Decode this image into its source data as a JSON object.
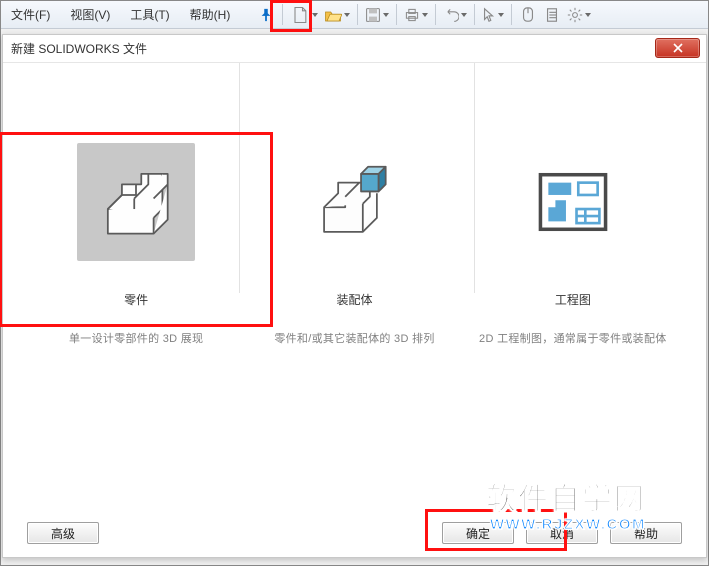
{
  "menubar": {
    "file": "文件(F)",
    "view": "视图(V)",
    "tools": "工具(T)",
    "help": "帮助(H)"
  },
  "toolbar_icons": {
    "pin": "pin-icon",
    "new_doc": "new-document-icon",
    "open": "open-icon",
    "save": "save-icon",
    "print": "print-icon",
    "undo": "undo-icon",
    "cursor": "cursor-icon",
    "rebuild": "rebuild-icon",
    "options_sheet": "options-sheet-icon",
    "settings": "gear-icon"
  },
  "dialog": {
    "title": "新建 SOLIDWORKS 文件",
    "options": [
      {
        "name": "零件",
        "desc": "单一设计零部件的 3D 展现"
      },
      {
        "name": "装配体",
        "desc": "零件和/或其它装配体的 3D 排列"
      },
      {
        "name": "工程图",
        "desc": "2D 工程制图，通常属于零件或装配体"
      }
    ],
    "buttons": {
      "advanced": "高级",
      "ok": "确定",
      "cancel": "取消",
      "help": "帮助"
    }
  },
  "watermark": {
    "line1": "软件自学网",
    "line2": "WWW.RJZXW.COM"
  }
}
